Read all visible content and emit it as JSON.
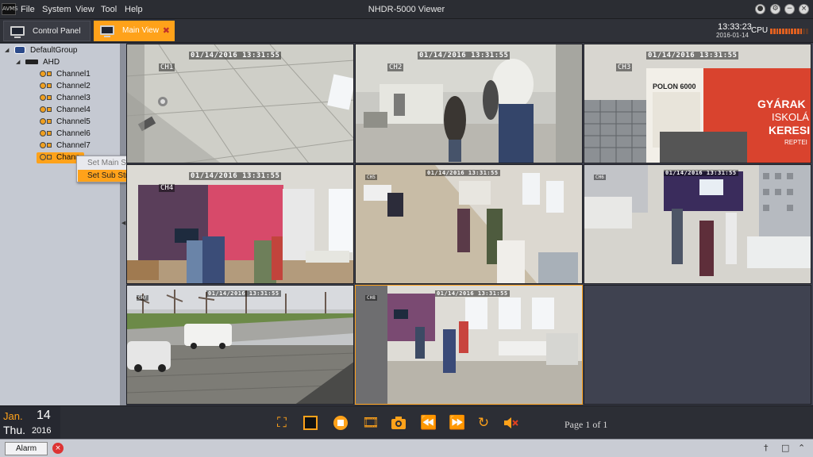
{
  "menubar": {
    "logo": "AVMS",
    "items": [
      "File",
      "System",
      "View",
      "Tool",
      "Help"
    ],
    "window_title": "NHDR-5000 Viewer"
  },
  "tabs": {
    "control_panel": "Control Panel",
    "main_view": "Main View"
  },
  "status_clock": {
    "time": "13:33:23",
    "date": "2016-01-14",
    "cpu_label": "CPU",
    "cpu_level": 0.85
  },
  "tree": {
    "group": "DefaultGroup",
    "device": "AHD",
    "channels": [
      "Channel1",
      "Channel2",
      "Channel3",
      "Channel4",
      "Channel5",
      "Channel6",
      "Channel7",
      "Chann"
    ]
  },
  "context_menu": {
    "items": [
      "Set Main Stream",
      "Set Sub Stream"
    ],
    "highlighted": "Set Sub Stream"
  },
  "cameras": [
    {
      "label": "CH1",
      "timestamp": "01/14/2016  13:31:55"
    },
    {
      "label": "CH2",
      "timestamp": "01/14/2016  13:31:55"
    },
    {
      "label": "CH3",
      "timestamp": "01/14/2016  13:31:55"
    },
    {
      "label": "CH4",
      "timestamp": "01/14/2016  13:31:55"
    },
    {
      "label": "CH5",
      "timestamp": "01/14/2016  13:31:55"
    },
    {
      "label": "CH6",
      "timestamp": "01/14/2016  13:31:55"
    },
    {
      "label": "CH7",
      "timestamp": "01/14/2016  13:31:55"
    },
    {
      "label": "CH8",
      "timestamp": "01/14/2016  13:31:55"
    }
  ],
  "scene_text": {
    "ch3_poster_title": "POLON 6000",
    "ch3_banner": [
      "GYÁRAK",
      "ISKOLÁ",
      "KERESI",
      "REPTEI"
    ]
  },
  "date_panel": {
    "month": "Jan.",
    "day": "14",
    "weekday": "Thu.",
    "year": "2016"
  },
  "playback": {
    "page_label": "Page 1 of 1",
    "buttons": [
      "fullscreen-icon",
      "single-view-icon",
      "stop-icon",
      "record-icon",
      "snapshot-icon",
      "rewind-icon",
      "fast-forward-icon",
      "refresh-icon",
      "mute-icon"
    ]
  },
  "statusbar": {
    "alarm_label": "Alarm"
  },
  "colors": {
    "accent": "#ffa21a",
    "background": "#3a3d48",
    "sidebar": "#c5c9d2"
  }
}
